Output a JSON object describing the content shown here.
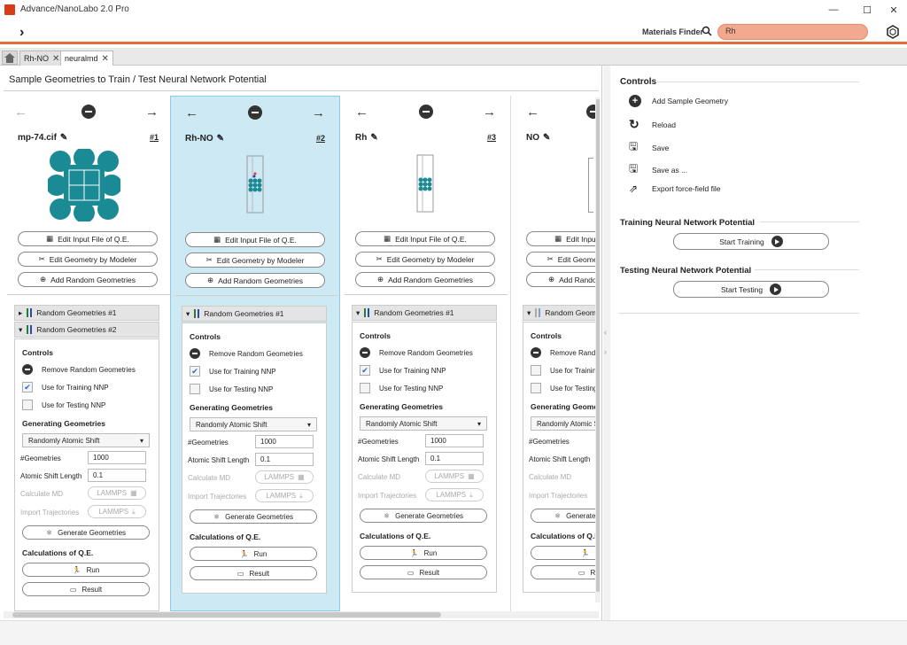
{
  "app": {
    "title": "Advance/NanoLabo 2.0 Pro"
  },
  "window_controls": {
    "minimize": "—",
    "maximize": "☐",
    "close": "✕"
  },
  "toolbar": {
    "toggle": "›",
    "materials_finder_label": "Materials Finder",
    "search_value": "Rh"
  },
  "tabs": [
    {
      "label": "Rh-NO",
      "active": false
    },
    {
      "label": "neuralmd",
      "active": true
    }
  ],
  "page": {
    "title": "Sample Geometries to Train / Test Neural Network Potential"
  },
  "columns": [
    {
      "name": "mp-74.cif",
      "num": "#1"
    },
    {
      "name": "Rh-NO",
      "num": "#2"
    },
    {
      "name": "Rh",
      "num": "#3"
    },
    {
      "name": "NO",
      "num": ""
    }
  ],
  "buttons": {
    "edit_input": "Edit Input File of Q.E.",
    "edit_geometry": "Edit Geometry by Modeler",
    "add_random": "Add Random Geometries"
  },
  "random_geometries": {
    "rg1": "Random Geometries  #1",
    "rg2": "Random Geometries  #2",
    "controls": "Controls",
    "remove": "Remove Random Geometries",
    "use_training": "Use for Training NNP",
    "use_testing": "Use for Testing NNP",
    "generating": "Generating Geometries",
    "method": "Randomly Atomic Shift",
    "n_geometries_label": "#Geometries",
    "shift_label": "Atomic Shift Length",
    "calc_md_label": "Calculate MD",
    "import_traj_label": "Import Trajectories",
    "lammps": "LAMMPS",
    "generate_btn": "Generate Geometries",
    "calc_qe": "Calculations of Q.E.",
    "run": "Run",
    "result": "Result"
  },
  "values": {
    "col1_n": "1000",
    "col1_shift": "0.1",
    "col2_n": "1000",
    "col2_shift": "0.1",
    "col3_n": "1000",
    "col3_shift": "0.1"
  },
  "right_panel": {
    "controls_title": "Controls",
    "items": [
      "Add Sample Geometry",
      "Reload",
      "Save",
      "Save as ...",
      "Export force-field file"
    ],
    "training_title": "Training Neural Network Potential",
    "start_training": "Start Training",
    "testing_title": "Testing Neural Network Potential",
    "start_testing": "Start Testing"
  },
  "colors": {
    "accent": "#e56a3a",
    "selected_col": "#cde9f4",
    "molecule": "#1a8a94"
  }
}
